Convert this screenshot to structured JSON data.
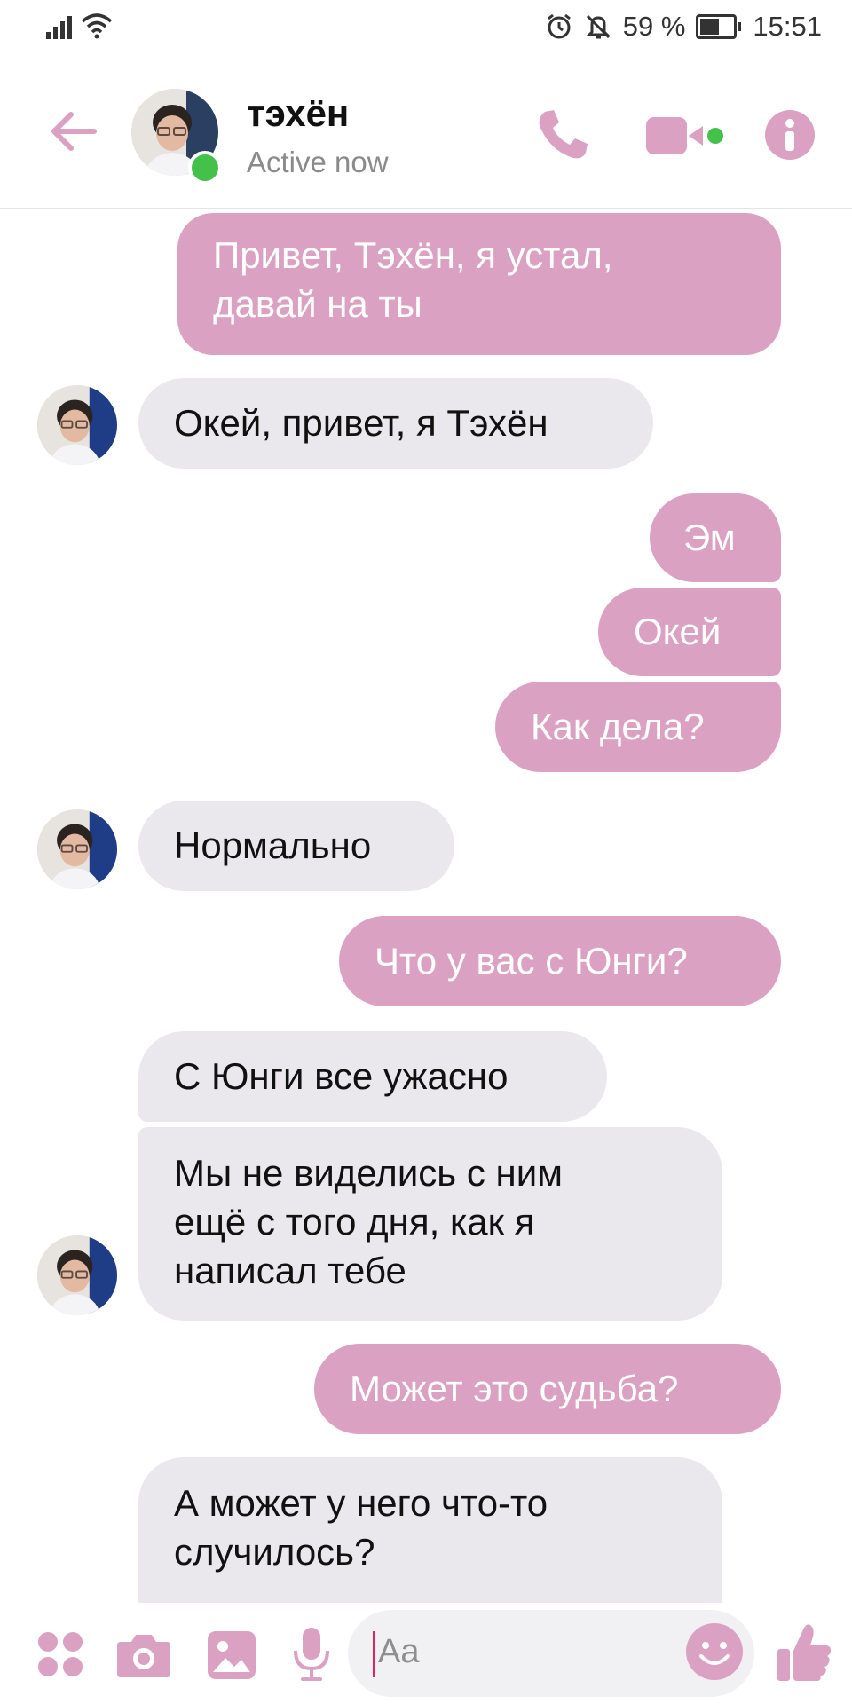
{
  "status_bar": {
    "battery": "59 %",
    "time": "15:51"
  },
  "header": {
    "contact_name": "тэхён",
    "status": "Active now"
  },
  "messages": [
    {
      "side": "out",
      "text": "Привет, Тэхён, я устал,\nдавай на ты"
    },
    {
      "side": "in",
      "text": "Окей, привет, я Тэхён"
    },
    {
      "side": "out",
      "text": "Эм"
    },
    {
      "side": "out",
      "text": "Окей"
    },
    {
      "side": "out",
      "text": "Как дела?"
    },
    {
      "side": "in",
      "text": "Нормально"
    },
    {
      "side": "out",
      "text": "Что у вас с Юнги?"
    },
    {
      "side": "in",
      "text": "С Юнги все ужасно"
    },
    {
      "side": "in",
      "text": "Мы не виделись с ним\nещё с того дня, как я\nнаписал тебе"
    },
    {
      "side": "out",
      "text": "Может это судьба?"
    },
    {
      "side": "in",
      "text": "А может у него что-то\nслучилось?"
    }
  ],
  "composer": {
    "placeholder": "Aa"
  },
  "colors": {
    "accent": "#dba1c2",
    "incoming_bubble": "#eae8ec",
    "online": "#43c14b"
  },
  "icons": [
    "signal-icon",
    "wifi-icon",
    "alarm-icon",
    "bell-off-icon",
    "battery-icon",
    "back-arrow-icon",
    "phone-icon",
    "video-camera-icon",
    "info-icon",
    "more-apps-icon",
    "camera-icon",
    "image-icon",
    "microphone-icon",
    "emoji-icon",
    "thumbs-up-icon"
  ]
}
